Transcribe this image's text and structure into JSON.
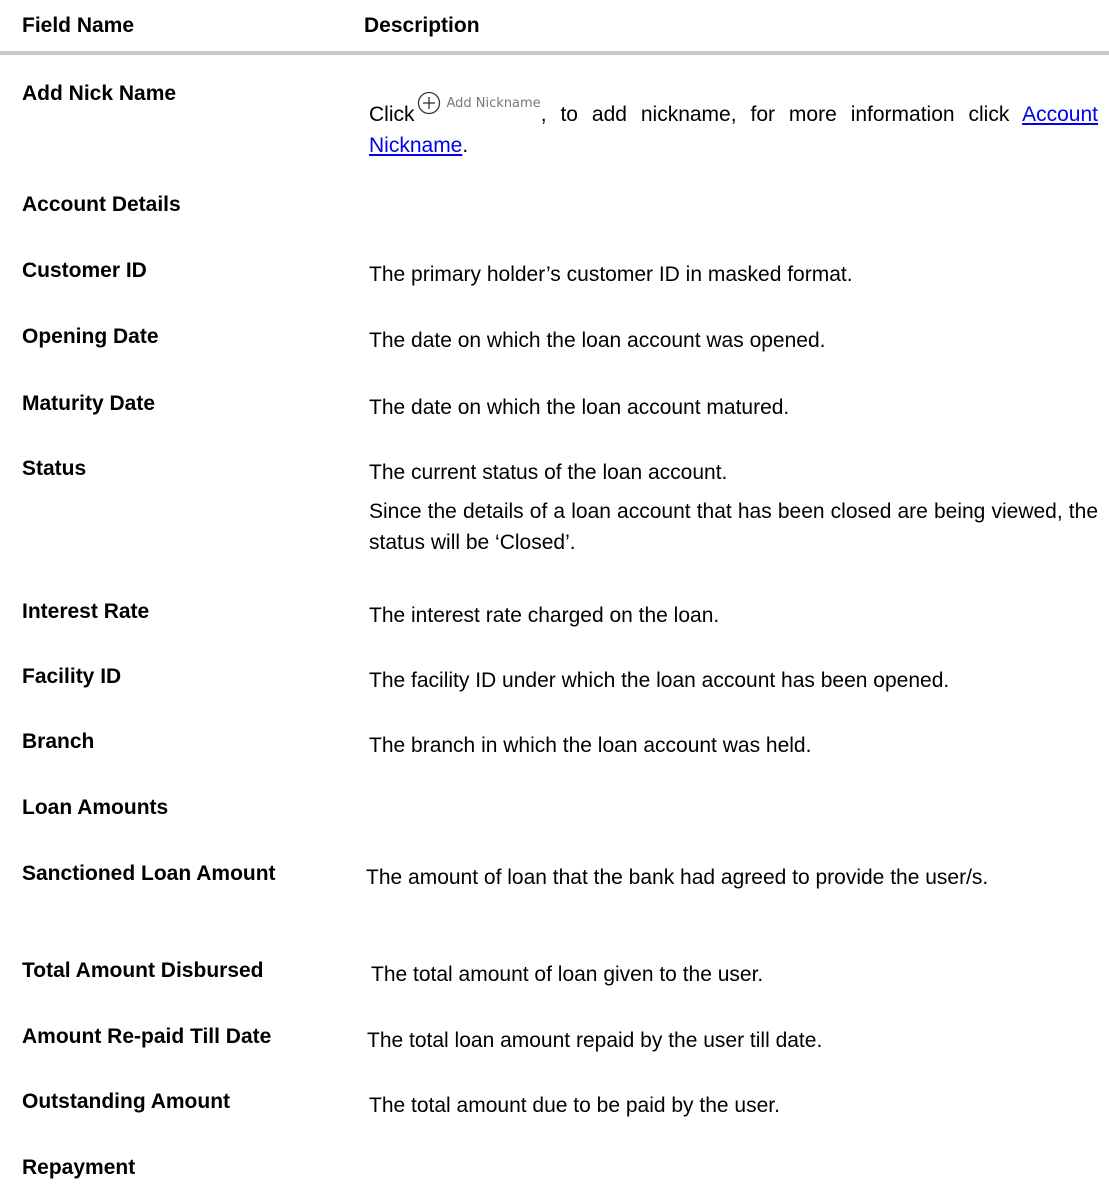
{
  "header": {
    "field_name": "Field Name",
    "description": "Description"
  },
  "add_nick_name": {
    "label": "Add Nick Name",
    "click_text": "Click",
    "button_label": "Add Nickname",
    "button_icon": "plus-circle-icon",
    "after_button_text": ", to add nickname, for more information click ",
    "link_text": "Account Nickname",
    "end_text": "."
  },
  "sections": {
    "account_details": "Account Details",
    "loan_amounts": "Loan Amounts",
    "repayment": "Repayment"
  },
  "rows": {
    "customer_id": {
      "label": "Customer ID",
      "desc": "The primary holder’s customer ID in masked format."
    },
    "opening_date": {
      "label": "Opening Date",
      "desc": "The date on which the loan account was opened."
    },
    "maturity_date": {
      "label": "Maturity Date",
      "desc": "The date on which the loan account matured."
    },
    "status": {
      "label": "Status",
      "desc": "The current status of the loan account.",
      "desc_2": "Since the details of a loan account that has been closed are being viewed, the status will be ‘Closed’."
    },
    "interest_rate": {
      "label": "Interest Rate",
      "desc": "The interest rate charged on the loan."
    },
    "facility_id": {
      "label": "Facility ID",
      "desc": "The facility ID under which the loan account has been opened."
    },
    "branch": {
      "label": "Branch",
      "desc": "The branch in which the loan account was held."
    },
    "sanctioned_loan_amount": {
      "label": "Sanctioned Loan Amount",
      "desc": "The amount of loan that the bank had agreed to provide the user/s."
    },
    "total_amount_disbursed": {
      "label": "Total Amount Disbursed",
      "desc": "The total amount of loan given to the user."
    },
    "amount_repaid_till_date": {
      "label": "Amount Re-paid Till Date",
      "desc": "The total loan amount repaid by the user till date."
    },
    "outstanding_amount": {
      "label": "Outstanding Amount",
      "desc": "The total amount due to be paid by the user."
    }
  }
}
